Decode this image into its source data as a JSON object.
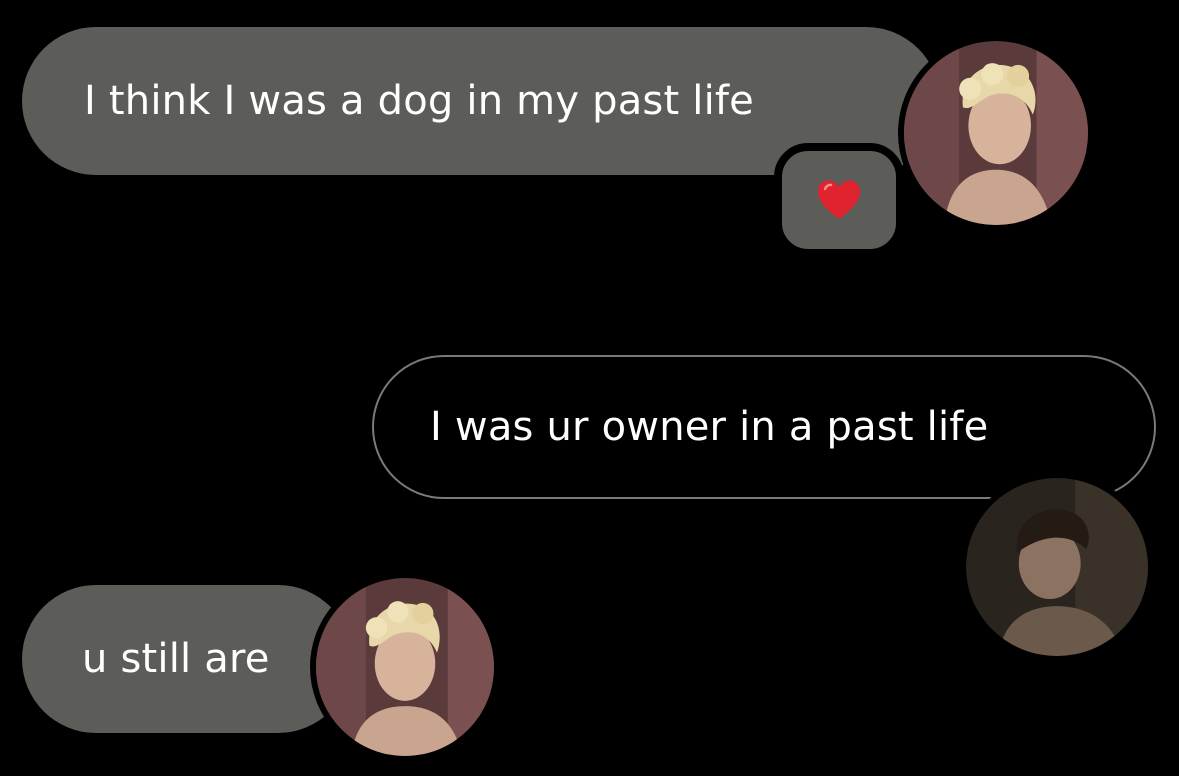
{
  "conversation": {
    "messages": [
      {
        "text": "I think I was a dog in my past life",
        "reaction": "heart-emoji"
      },
      {
        "text": "I was ur owner in a past life"
      },
      {
        "text": "u still are"
      }
    ]
  },
  "colors": {
    "background": "#000000",
    "incoming_bubble": "#5c5c58",
    "outgoing_bubble_border": "#7a7a7a",
    "text": "#ffffff",
    "heart": "#e0242f"
  },
  "icons": {
    "reaction": "heart-emoji",
    "avatar_blonde": "avatar-photo",
    "avatar_dark": "avatar-photo"
  }
}
